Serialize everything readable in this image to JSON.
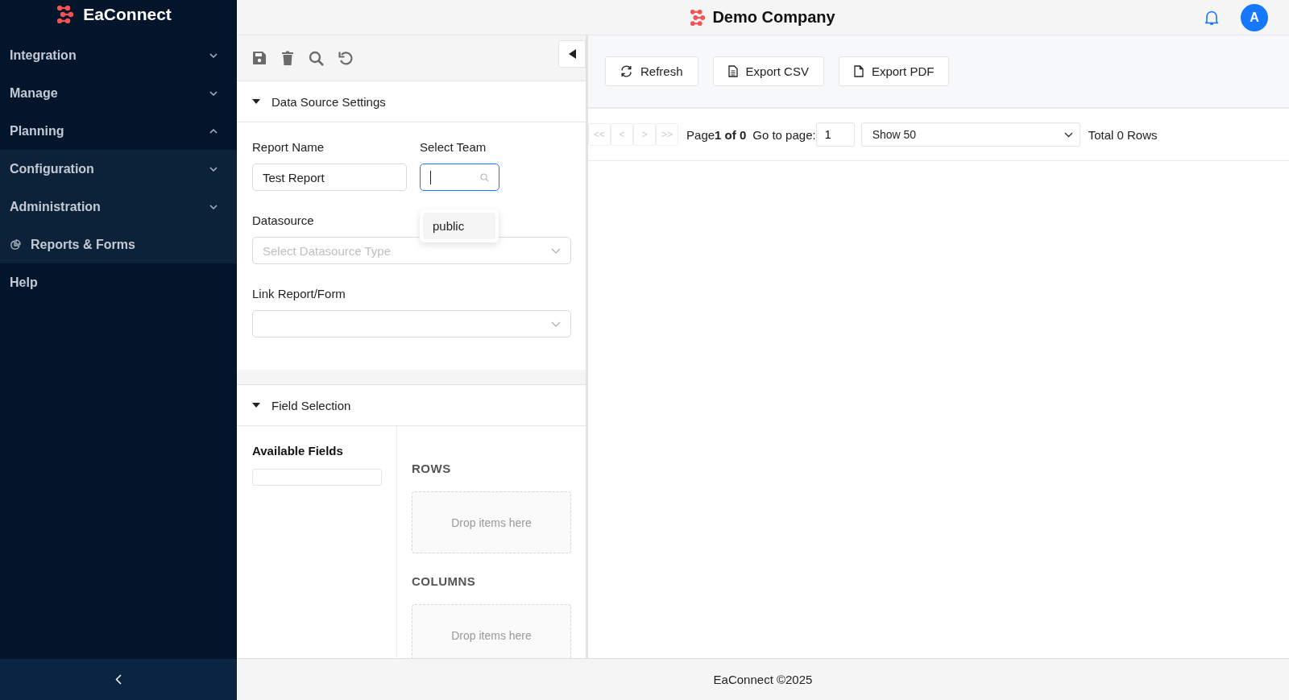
{
  "sidebar": {
    "brand": "EaConnect",
    "items": [
      {
        "label": "Integration",
        "kind": "group",
        "expanded": false
      },
      {
        "label": "Manage",
        "kind": "group",
        "expanded": false
      },
      {
        "label": "Planning",
        "kind": "group",
        "expanded": true,
        "children": [
          {
            "label": "Configuration",
            "kind": "group",
            "expanded": false
          },
          {
            "label": "Administration",
            "kind": "group",
            "expanded": false
          },
          {
            "label": "Reports & Forms",
            "kind": "link"
          }
        ]
      },
      {
        "label": "Help",
        "kind": "plain"
      }
    ]
  },
  "header": {
    "company": "Demo Company",
    "avatar": "A"
  },
  "data_source_settings": {
    "title": "Data Source Settings",
    "expanded": true,
    "report_name": {
      "label": "Report Name",
      "value": "Test Report"
    },
    "team": {
      "label": "Select Team",
      "open": true,
      "options": [
        {
          "label": "public",
          "selected": false
        }
      ]
    },
    "datasource": {
      "label": "Datasource",
      "placeholder": "Select Datasource Type"
    },
    "link_report": {
      "label": "Link Report/Form"
    }
  },
  "field_selection": {
    "title": "Field Selection",
    "expanded": true,
    "available_fields": "Available Fields",
    "zones": [
      {
        "title": "ROWS",
        "hint": "Drop items here"
      },
      {
        "title": "COLUMNS",
        "hint": "Drop items here"
      }
    ]
  },
  "report_toolbar": {
    "buttons": [
      {
        "kind": "refresh",
        "label": "Refresh"
      },
      {
        "kind": "csv",
        "label": "Export CSV"
      },
      {
        "kind": "pdf",
        "label": "Export PDF"
      }
    ]
  },
  "pagination": {
    "nav": [
      {
        "label": "<<",
        "disabled": true
      },
      {
        "label": "<",
        "disabled": true
      },
      {
        "label": ">",
        "disabled": true
      },
      {
        "label": ">>",
        "disabled": true
      }
    ],
    "page_info": "Page**1 of 0**",
    "goto_label": "Go to page:",
    "goto_value": "1",
    "page_size": "Show 50",
    "total": "Total 0 Rows"
  },
  "footer": "EaConnect ©2025"
}
